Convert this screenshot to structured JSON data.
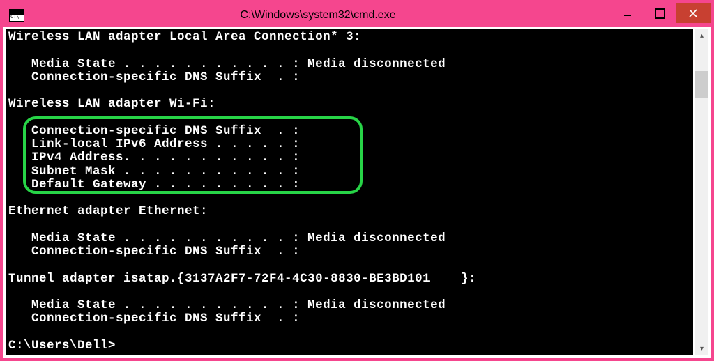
{
  "window": {
    "title": "C:\\Windows\\system32\\cmd.exe"
  },
  "console": {
    "lines": [
      "Wireless LAN adapter Local Area Connection* 3:",
      "",
      "   Media State . . . . . . . . . . . : Media disconnected",
      "   Connection-specific DNS Suffix  . :",
      "",
      "Wireless LAN adapter Wi-Fi:",
      "",
      "   Connection-specific DNS Suffix  . :",
      "   Link-local IPv6 Address . . . . . :",
      "   IPv4 Address. . . . . . . . . . . :",
      "   Subnet Mask . . . . . . . . . . . :",
      "   Default Gateway . . . . . . . . . :",
      "",
      "Ethernet adapter Ethernet:",
      "",
      "   Media State . . . . . . . . . . . : Media disconnected",
      "   Connection-specific DNS Suffix  . :",
      "",
      "Tunnel adapter isatap.{3137A2F7-72F4-4C30-8830-BE3BD101    }:",
      "",
      "   Media State . . . . . . . . . . . : Media disconnected",
      "   Connection-specific DNS Suffix  . :",
      "",
      "C:\\Users\\Dell>"
    ]
  }
}
